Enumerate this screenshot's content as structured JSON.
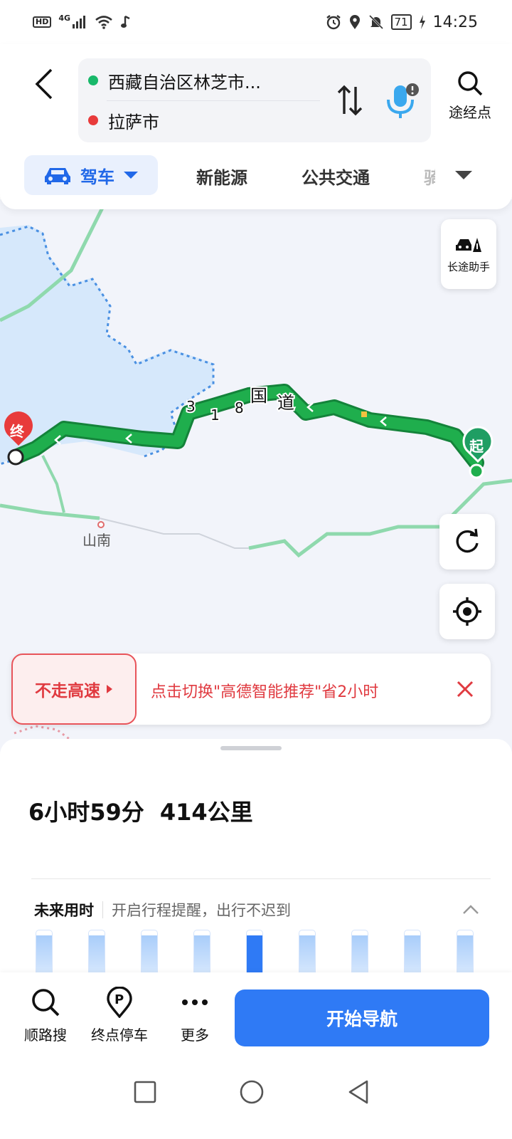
{
  "status_bar": {
    "hd_badge": "HD",
    "network": "4G",
    "battery": "71",
    "time": "14:25"
  },
  "search": {
    "origin": "西藏自治区林芝市...",
    "destination": "拉萨市",
    "waypoint_label": "途经点",
    "origin_color": "#18b86a",
    "destination_color": "#e83b3b"
  },
  "modes": {
    "active": "驾车",
    "tabs": [
      "新能源",
      "公共交通",
      "骑"
    ]
  },
  "map": {
    "road_label": "318国道",
    "road_chars": [
      "3",
      "1",
      "8",
      "国",
      "道"
    ],
    "end_marker": "终",
    "start_marker": "起",
    "place_label": "山南",
    "long_trip_label": "长途助手",
    "route_color": "#1fae4d",
    "water_color": "#d6e8fb"
  },
  "banner": {
    "button_label": "不走高速",
    "message": "点击切换\"高德智能推荐\"省2小时"
  },
  "sheet": {
    "duration": "6小时59分",
    "distance": "414公里",
    "future_title": "未来用时",
    "future_hint": "开启行程提醒，出行不迟到",
    "bars": [
      {
        "level": 0.9,
        "selected": false
      },
      {
        "level": 0.9,
        "selected": false
      },
      {
        "level": 0.9,
        "selected": false
      },
      {
        "level": 0.9,
        "selected": false
      },
      {
        "level": 0.9,
        "selected": true
      },
      {
        "level": 0.9,
        "selected": false
      },
      {
        "level": 0.9,
        "selected": false
      },
      {
        "level": 0.9,
        "selected": false
      },
      {
        "level": 0.9,
        "selected": false
      }
    ]
  },
  "actions": {
    "search_along": "顺路搜",
    "parking": "终点停车",
    "more": "更多",
    "start_nav": "开始导航",
    "accent": "#2f7af5"
  }
}
